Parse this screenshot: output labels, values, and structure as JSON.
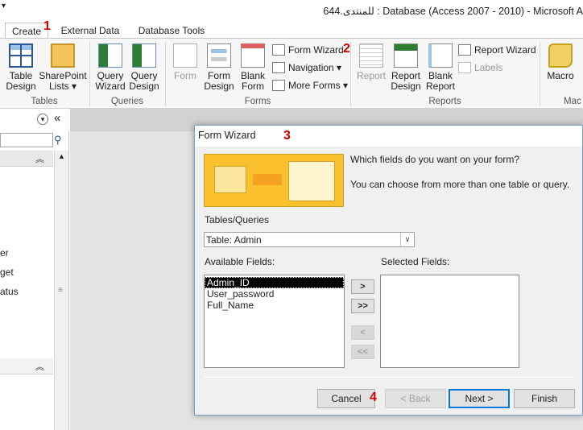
{
  "window": {
    "title": "Database (Access 2007 - 2010)  -  Microsoft A",
    "title_rtl_prefix": "644.للمنتدى :",
    "quick_access_glyph": "▾"
  },
  "tabs": [
    {
      "label": "Create"
    },
    {
      "label": "External Data"
    },
    {
      "label": "Database Tools"
    }
  ],
  "markers": [
    "1",
    "2",
    "3",
    "4"
  ],
  "ribbon": {
    "groups": {
      "tables": "Tables",
      "queries": "Queries",
      "forms": "Forms",
      "reports": "Reports",
      "macros": "Mac"
    },
    "table_design": [
      "Table",
      "Design"
    ],
    "sharepoint_lists": [
      "SharePoint",
      "Lists ▾"
    ],
    "query_wizard": [
      "Query",
      "Wizard"
    ],
    "query_design": [
      "Query",
      "Design"
    ],
    "form": "Form",
    "form_design": [
      "Form",
      "Design"
    ],
    "blank_form": [
      "Blank",
      "Form"
    ],
    "form_wizard": "Form Wizard",
    "navigation": "Navigation ▾",
    "more_forms": "More Forms ▾",
    "report": "Report",
    "report_design": [
      "Report",
      "Design"
    ],
    "blank_report": [
      "Blank",
      "Report"
    ],
    "report_wizard": "Report Wizard",
    "labels": "Labels",
    "macro": "Macro"
  },
  "nav": {
    "items": [
      "er",
      "get",
      "atus"
    ],
    "collapse_glyph": "«",
    "dropdown_glyph": "▾",
    "group_toggle": "︽"
  },
  "dialog": {
    "title": "Form Wizard",
    "question": "Which fields do you want on your form?",
    "hint": "You can choose from more than one table or query.",
    "tables_label": "Tables/Queries",
    "combo_value": "Table: Admin",
    "available_label": "Available Fields:",
    "selected_label": "Selected Fields:",
    "available_fields": [
      "Admin_ID",
      "User_password",
      "Full_Name"
    ],
    "selected_fields": [],
    "move_buttons": [
      ">",
      ">>",
      "<",
      "<<"
    ],
    "buttons": {
      "cancel": "Cancel",
      "back": "< Back",
      "next": "Next >",
      "finish": "Finish"
    }
  }
}
